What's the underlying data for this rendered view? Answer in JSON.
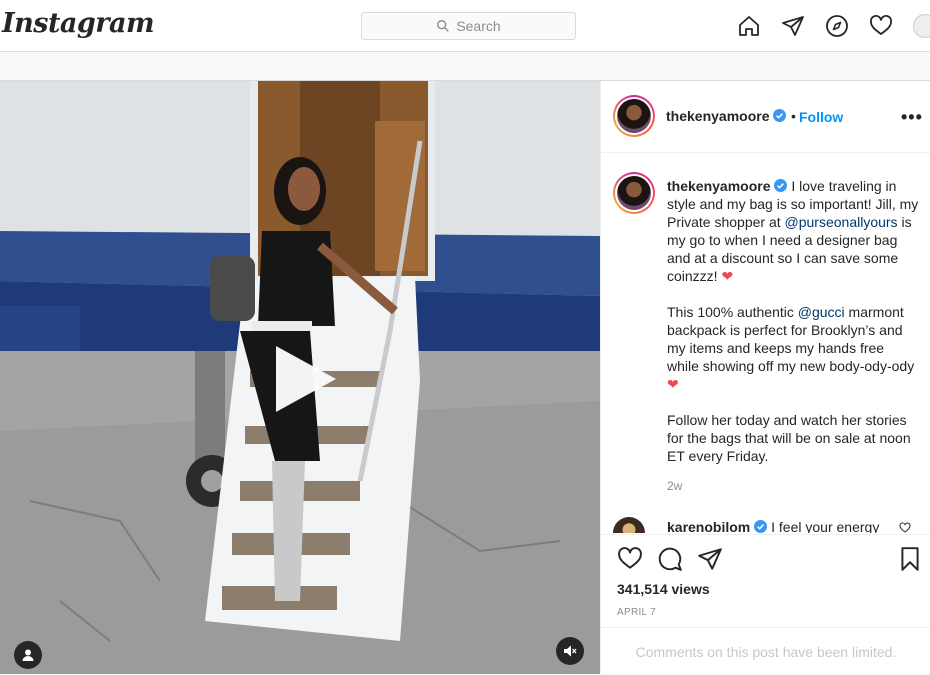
{
  "nav": {
    "logo": "Instagram",
    "search_placeholder": "Search"
  },
  "post": {
    "author": "thekenyamoore",
    "follow_label": "Follow",
    "separator": "•",
    "more_label": "•••",
    "caption": {
      "line1_pre": "I love traveling in style and my bag is so important! Jill, my Private shopper at ",
      "mention1": "@purseonallyours",
      "line1_post": " is my go to when I need a designer bag and at a discount so I can save some coinzzz! ",
      "p2_pre": "This 100% authentic ",
      "mention2": "@gucci",
      "p2_post": " marmont backpack is perfect for Brooklyn’s and my items and keeps my hands free while showing off my new body-ody-ody ",
      "p3": "Follow her today and watch her stories for the bags that will be on sale at noon ET every Friday.",
      "heart": "❤"
    },
    "age": "2w",
    "comment": {
      "author": "karenobilom",
      "text": "I feel your energy"
    },
    "views": "341,514 views",
    "date": "APRIL 7",
    "comments_limited": "Comments on this post have been limited."
  },
  "colors": {
    "accent": "#0095f6",
    "heart": "#ed4956",
    "mention": "#00376b"
  },
  "icons": [
    "home-icon",
    "direct-icon",
    "explore-icon",
    "activity-heart-icon",
    "like-icon",
    "comment-icon",
    "share-icon",
    "save-icon",
    "play-icon",
    "mute-icon",
    "user-tag-icon",
    "verified-badge-icon"
  ]
}
